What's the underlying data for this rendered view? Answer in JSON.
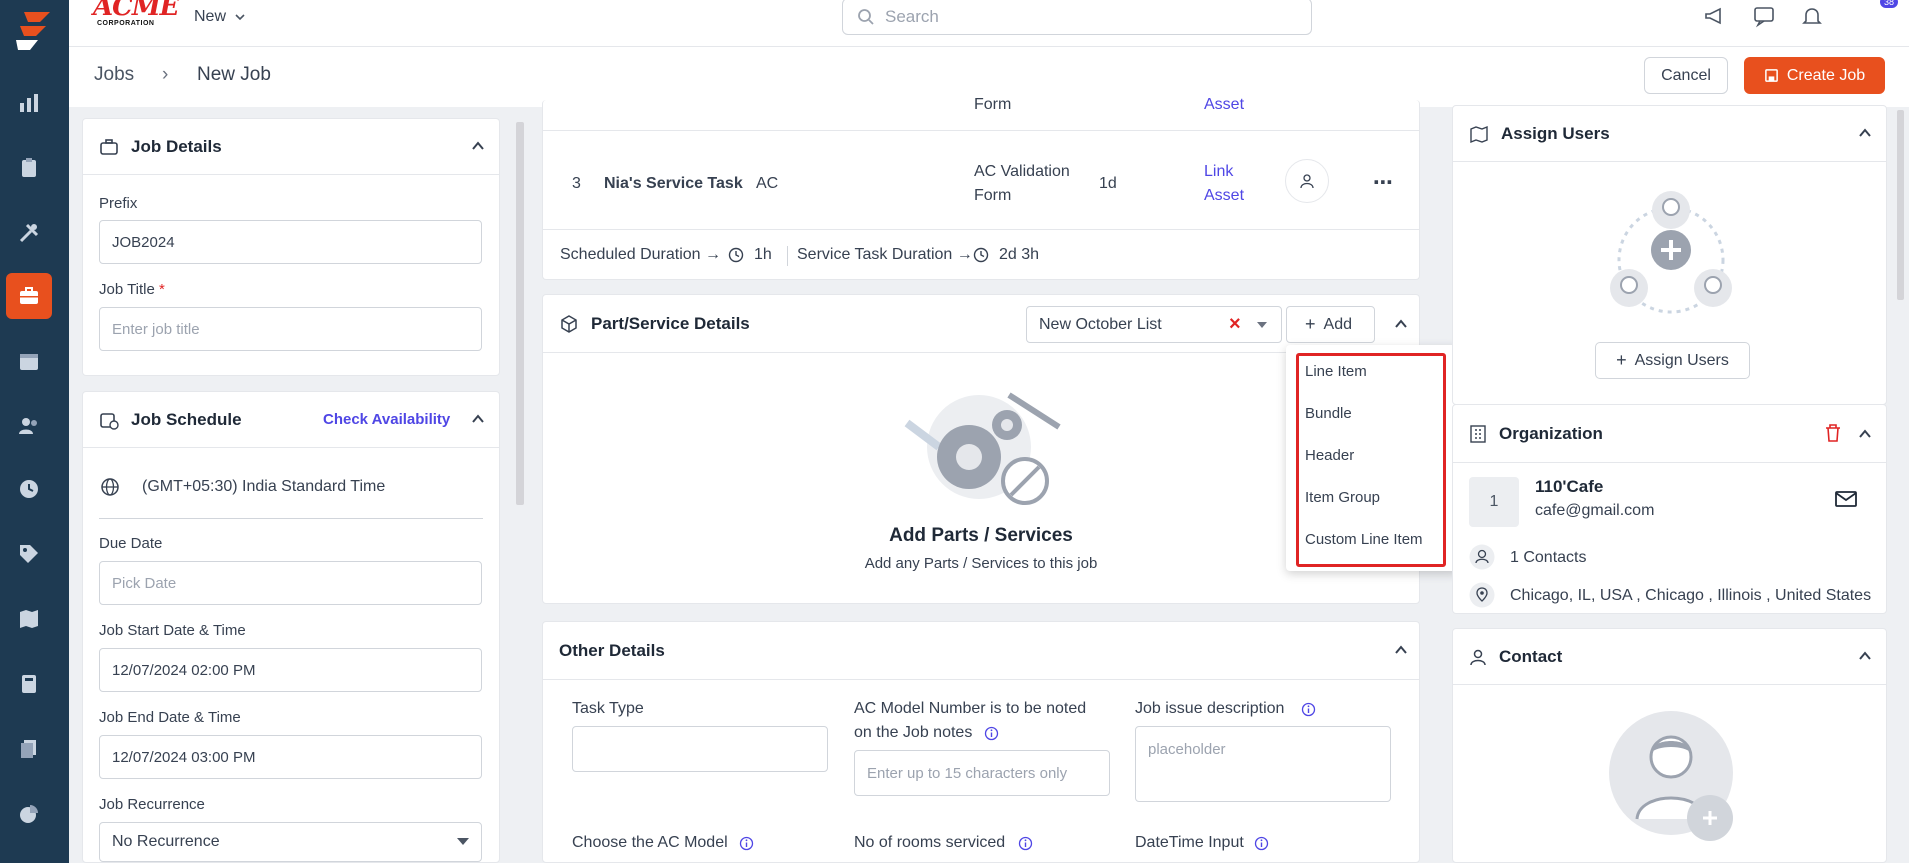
{
  "brand": {
    "logo_text": "ACME",
    "logo_sub": "CORPORATION",
    "colors": {
      "accent": "#e8501e",
      "sidebar": "#1e3a52",
      "link": "#4f46e5",
      "danger": "#e02424"
    }
  },
  "topbar": {
    "new_label": "New",
    "search_placeholder": "Search",
    "notification_count": "38"
  },
  "sidebar": {
    "icons": [
      "dashboard-chart-icon",
      "clipboard-icon",
      "tools-icon",
      "briefcase-icon",
      "calendar-icon",
      "users-icon",
      "clock-icon",
      "tag-icon",
      "map-icon",
      "calculator-icon",
      "documents-icon",
      "pie-chart-icon"
    ],
    "active_index": 3
  },
  "breadcrumb": {
    "root": "Jobs",
    "separator": "›",
    "current": "New Job"
  },
  "actions": {
    "cancel": "Cancel",
    "create": "Create Job"
  },
  "job_details": {
    "title": "Job Details",
    "prefix_label": "Prefix",
    "prefix_value": "JOB2024",
    "job_title_label": "Job Title",
    "required_mark": "*",
    "job_title_placeholder": "Enter job title"
  },
  "job_schedule": {
    "title": "Job Schedule",
    "check_availability": "Check Availability",
    "timezone": "(GMT+05:30) India Standard Time",
    "due_date_label": "Due Date",
    "due_date_placeholder": "Pick Date",
    "start_label": "Job Start Date & Time",
    "start_value": "12/07/2024 02:00 PM",
    "end_label": "Job End Date & Time",
    "end_value": "12/07/2024 03:00 PM",
    "recurrence_label": "Job Recurrence",
    "recurrence_value": "No Recurrence"
  },
  "service_tasks": {
    "prev_row": {
      "form_tail": "Form",
      "link_tail": "Asset"
    },
    "row": {
      "index": "3",
      "name": "Nia's Service Task",
      "type": "AC",
      "form_line1": "AC Validation",
      "form_line2": "Form",
      "duration": "1d",
      "link_line1": "Link",
      "link_line2": "Asset"
    },
    "summary": {
      "scheduled_label": "Scheduled Duration →",
      "scheduled_value": "1h",
      "task_label": "Service Task Duration →",
      "task_value": "2d 3h"
    }
  },
  "parts": {
    "title": "Part/Service Details",
    "list_value": "New October List",
    "add_label": "Add",
    "empty_title": "Add Parts / Services",
    "empty_sub": "Add any Parts / Services to this job",
    "menu": [
      "Line Item",
      "Bundle",
      "Header",
      "Item Group",
      "Custom Line Item"
    ]
  },
  "other_details": {
    "title": "Other Details",
    "task_type_label": "Task Type",
    "ac_model_label_1": "AC Model Number is to be noted",
    "ac_model_label_2": "on the Job notes",
    "ac_model_placeholder": "Enter up to 15 characters only",
    "issue_label": "Job issue description",
    "issue_placeholder": "placeholder",
    "choose_model_label": "Choose the AC Model",
    "rooms_label": "No of rooms serviced",
    "datetime_label": "DateTime Input"
  },
  "assign_users": {
    "title": "Assign Users",
    "button": "Assign Users"
  },
  "organization": {
    "title": "Organization",
    "badge": "1",
    "name": "110'Cafe",
    "email": "cafe@gmail.com",
    "contacts": "1 Contacts",
    "address": "Chicago, IL, USA , Chicago , Illinois , United States"
  },
  "contact": {
    "title": "Contact"
  }
}
